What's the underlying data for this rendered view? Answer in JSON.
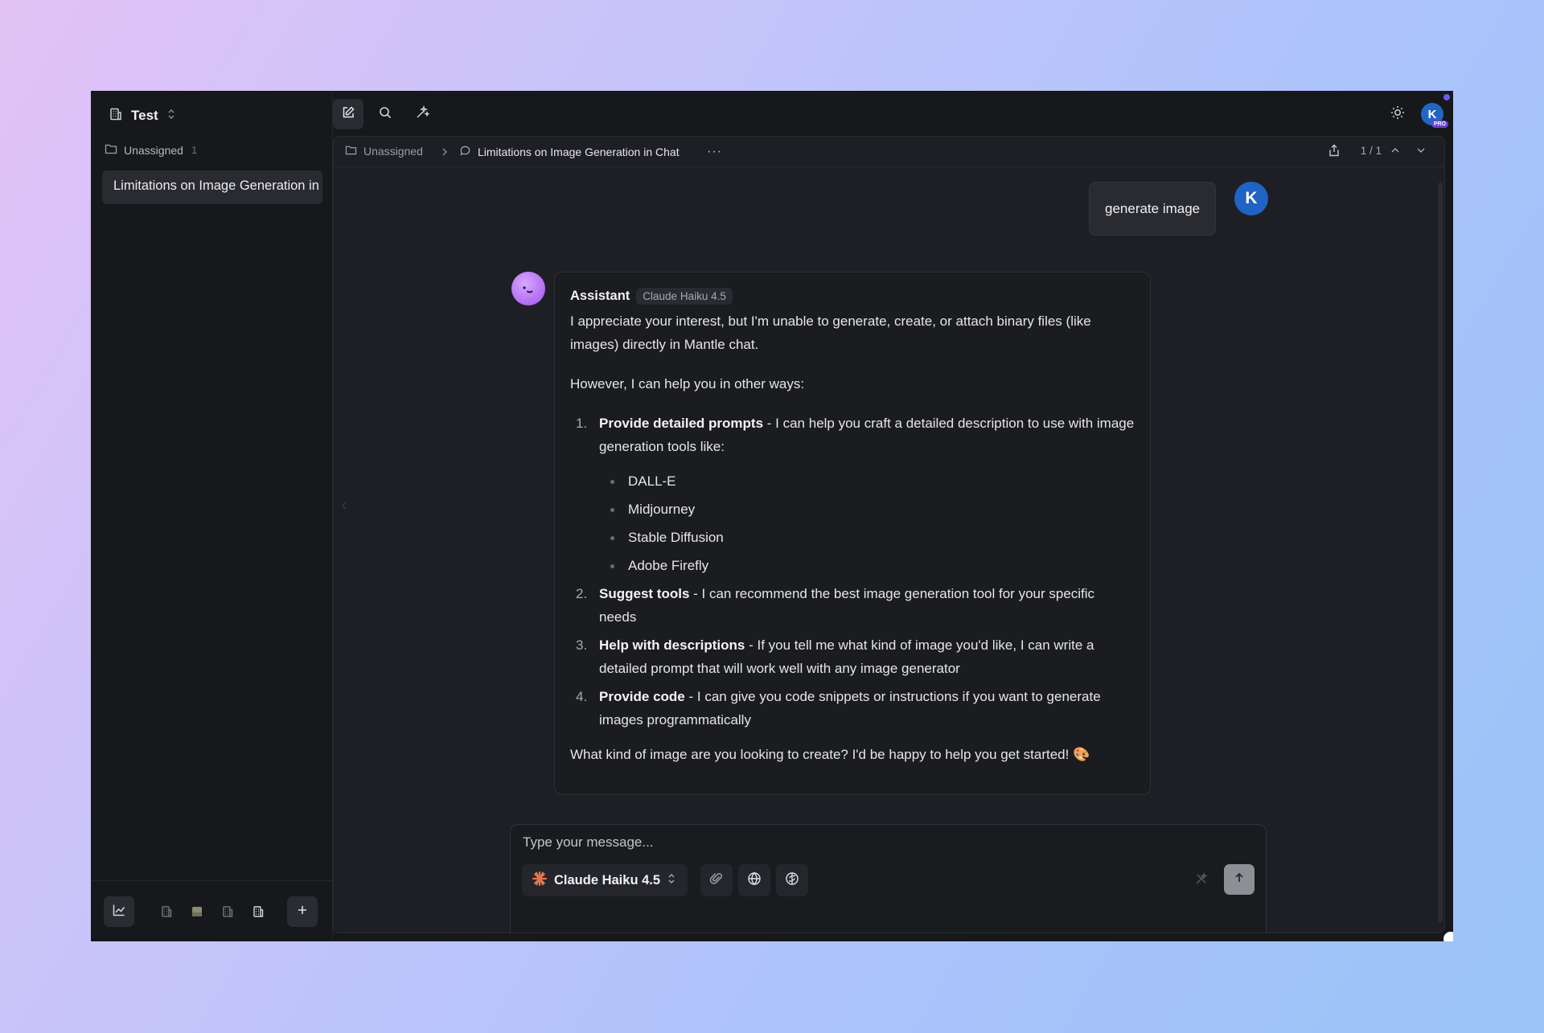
{
  "workspace": {
    "name": "Test"
  },
  "sidebar": {
    "folder": {
      "label": "Unassigned",
      "count": "1"
    },
    "chats": [
      {
        "title": "Limitations on Image Generation in Chat"
      }
    ]
  },
  "breadcrumb": {
    "folder": "Unassigned",
    "chat_title": "Limitations on Image Generation in Chat",
    "pager": "1 / 1"
  },
  "user": {
    "initial": "K",
    "badge": "PRO"
  },
  "messages": {
    "user_text": "generate image",
    "assistant_name": "Assistant",
    "assistant_model": "Claude Haiku 4.5",
    "intro": "I appreciate your interest, but I'm unable to generate, create, or attach binary files (like images) directly in Mantle chat.",
    "however": "However, I can help you in other ways:",
    "items": [
      {
        "num": "1.",
        "title": "Provide detailed prompts",
        "text": " - I can help you craft a detailed description to use with image generation tools like:"
      },
      {
        "num": "2.",
        "title": "Suggest tools",
        "text": " - I can recommend the best image generation tool for your specific needs"
      },
      {
        "num": "3.",
        "title": "Help with descriptions",
        "text": " - If you tell me what kind of image you'd like, I can write a detailed prompt that will work well with any image generator"
      },
      {
        "num": "4.",
        "title": "Provide code",
        "text": " - I can give you code snippets or instructions if you want to generate images programmatically"
      }
    ],
    "tools": [
      "DALL-E",
      "Midjourney",
      "Stable Diffusion",
      "Adobe Firefly"
    ],
    "closing": "What kind of image are you looking to create? I'd be happy to help you get started! 🎨"
  },
  "composer": {
    "placeholder": "Type your message...",
    "model": "Claude Haiku 4.5"
  },
  "colors": {
    "accent_blue": "#1f63c4",
    "pro_purple": "#6d3fd8",
    "assistant_avatar": "#b06cf2"
  }
}
